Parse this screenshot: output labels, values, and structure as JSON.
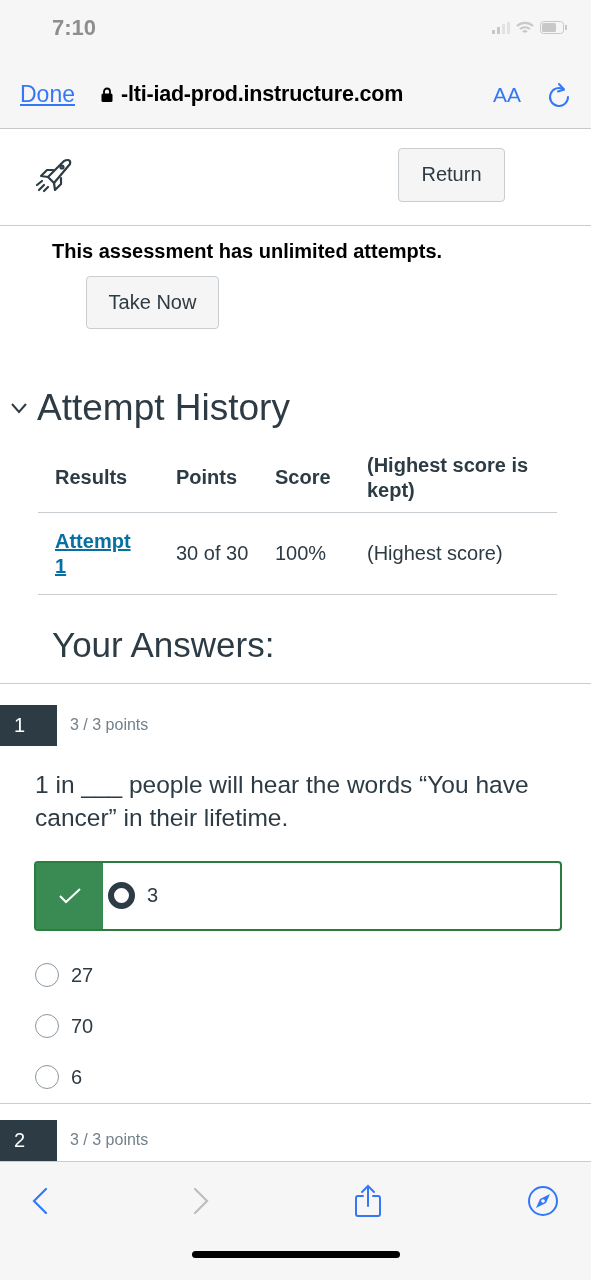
{
  "status_bar": {
    "time": "7:10"
  },
  "browser": {
    "done": "Done",
    "url": "-lti-iad-prod.instructure.com",
    "text_size": "AA"
  },
  "header": {
    "return_button": "Return"
  },
  "intro": {
    "message": "This assessment has unlimited attempts.",
    "take_now": "Take Now"
  },
  "attempt_history": {
    "title": "Attempt History",
    "expanded": true,
    "columns": [
      "Results",
      "Points",
      "Score",
      "(Highest score is kept)"
    ],
    "rows": [
      {
        "attempt": "Attempt 1",
        "points": "30 of 30",
        "score": "100%",
        "note": "(Highest score)"
      }
    ]
  },
  "answers_title": "Your Answers:",
  "questions": [
    {
      "number": "1",
      "points": "3 / 3 points",
      "text": "1 in ___ people will hear the words “You have cancer” in their lifetime.",
      "options": [
        {
          "label": "3",
          "selected": true,
          "correct": true
        },
        {
          "label": "27",
          "selected": false,
          "correct": false
        },
        {
          "label": "70",
          "selected": false,
          "correct": false
        },
        {
          "label": "6",
          "selected": false,
          "correct": false
        }
      ]
    },
    {
      "number": "2",
      "points": "3 / 3 points"
    }
  ],
  "toolbar": {
    "back_disabled": false,
    "forward_disabled": true
  }
}
